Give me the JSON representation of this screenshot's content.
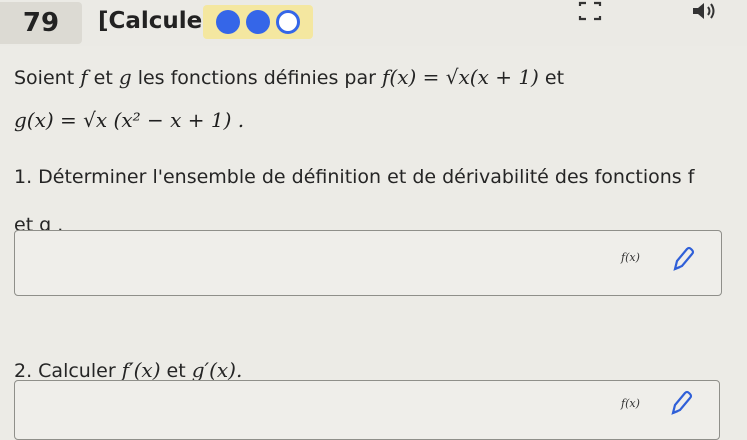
{
  "header": {
    "question_number": "79",
    "tag": "[Calculer.]",
    "progress_dots": [
      "filled",
      "filled",
      "empty"
    ],
    "icons": [
      "screen-icon",
      "speaker-icon"
    ]
  },
  "statement": {
    "intro": "Soient",
    "f": "f",
    "et": "et",
    "g": "g",
    "rest": "les fonctions définies par",
    "f_def": "f(x) = √x(x + 1)",
    "et2": "et",
    "g_def": "g(x) = √x (x² − x + 1) ."
  },
  "question1": {
    "line1": "1. Déterminer l'ensemble de définition et de dérivabilité des fonctions f",
    "line2": "et g ."
  },
  "answer1": {
    "label": "f(x)"
  },
  "question2": {
    "text_prefix": "2. Calculer",
    "f_prime": "f′(x)",
    "et": "et",
    "g_prime": "g′(x)."
  },
  "answer2": {
    "label": "f(x)"
  },
  "colors": {
    "accent": "#3566e8",
    "dots_bg": "#f4e7a0",
    "background": "#ecebe6"
  }
}
